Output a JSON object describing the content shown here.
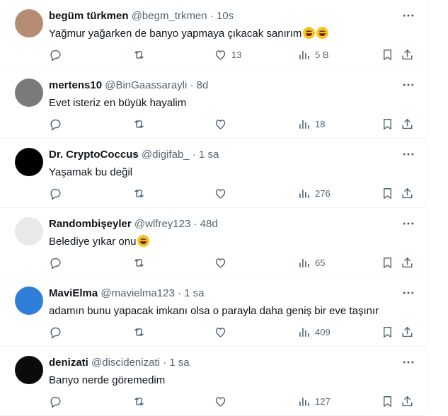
{
  "tweets": [
    {
      "name": "begüm türkmen",
      "handle": "@begm_trkmen",
      "sep": "·",
      "time": "10s",
      "text": "Yağmur yağarken de banyo yapmaya çıkacak sanırım",
      "emoji": [
        "joy-emoji",
        "joy-emoji"
      ],
      "likes": "13",
      "views": "5 B",
      "avatar_color": "#b58b74"
    },
    {
      "name": "mertens10",
      "handle": "@BinGaassarayli",
      "sep": "·",
      "time": "8d",
      "text": "Evet isteriz en büyük hayalim",
      "emoji": [],
      "likes": "",
      "views": "18",
      "avatar_color": "#7a7a7a"
    },
    {
      "name": "Dr. CryptoCoccus",
      "handle": "@digifab_",
      "sep": "·",
      "time": "1 sa",
      "text": "Yaşamak bu değil",
      "emoji": [],
      "likes": "",
      "views": "276",
      "avatar_color": "#000000"
    },
    {
      "name": "Randombişeyler",
      "handle": "@wlfrey123",
      "sep": "·",
      "time": "48d",
      "text": "Belediye yıkar onu",
      "emoji": [
        "grin-emoji"
      ],
      "likes": "",
      "views": "65",
      "avatar_color": "#e9e9e9"
    },
    {
      "name": "MaviElma",
      "handle": "@mavielma123",
      "sep": "·",
      "time": "1 sa",
      "text": "adamın bunu yapacak imkanı olsa o parayla daha geniş bir eve taşınır",
      "emoji": [],
      "likes": "",
      "views": "409",
      "avatar_color": "#2f7fd8"
    },
    {
      "name": "denizati",
      "handle": "@discidenizati",
      "sep": "·",
      "time": "1 sa",
      "text": "Banyo nerde göremedim",
      "emoji": [],
      "likes": "",
      "views": "127",
      "avatar_color": "#0b0b0b"
    }
  ],
  "colors": {
    "text": "#0f1419",
    "muted": "#536471",
    "border": "#eff3f4"
  }
}
